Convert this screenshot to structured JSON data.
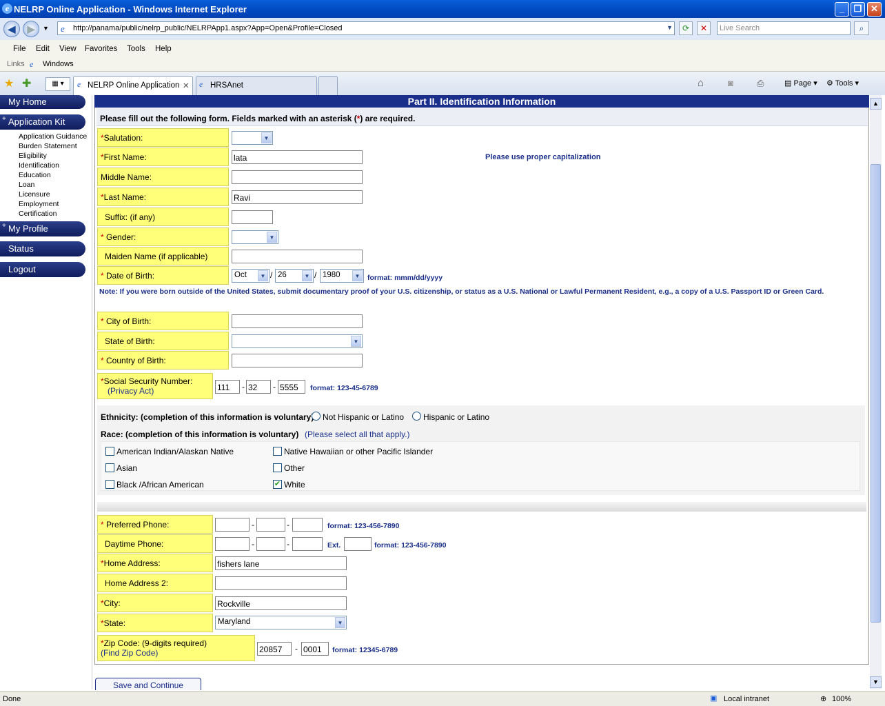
{
  "window": {
    "title": "NELRP Online Application - Windows Internet Explorer"
  },
  "browser": {
    "url": "http://panama/public/nelrp_public/NELRPApp1.aspx?App=Open&Profile=Closed",
    "search_placeholder": "Live Search",
    "menu": [
      "File",
      "Edit",
      "View",
      "Favorites",
      "Tools",
      "Help"
    ],
    "links_label": "Links",
    "links_item": "Windows",
    "tabs": [
      "NELRP Online Application",
      "HRSAnet"
    ],
    "cmd_page": "Page",
    "cmd_tools": "Tools"
  },
  "sidebar": {
    "my_home": "My Home",
    "app_kit": "Application Kit",
    "sub": [
      "Application Guidance",
      "Burden Statement",
      "Eligibility",
      "Identification",
      "Education",
      "Loan",
      "Licensure",
      "Employment",
      "Certification"
    ],
    "my_profile": "My Profile",
    "status": "Status",
    "logout": "Logout"
  },
  "form": {
    "header": "Part II. Identification Information",
    "instruction_pre": "Please fill out the following form. Fields marked with an asterisk (",
    "instruction_ast": "*",
    "instruction_post": ") are required.",
    "salutation": "Salutation:",
    "first_name": "First Name:",
    "first_name_value": "lata",
    "cap_hint": "Please use proper capitalization",
    "middle_name": "Middle Name:",
    "last_name": "Last Name:",
    "last_name_value": "Ravi",
    "suffix": "Suffix: (if any)",
    "gender": "Gender:",
    "maiden": "Maiden Name (if applicable)",
    "dob": "Date of Birth:",
    "dob_month": "Oct",
    "dob_day": "26",
    "dob_year": "1980",
    "dob_format": "format: mmm/dd/yyyy",
    "birth_note": "Note: If you were born outside of the United States, submit documentary proof of your U.S. citizenship, or status as a U.S. National or Lawful Permanent Resident, e.g., a copy of a U.S. Passport ID or Green Card.",
    "city_birth": "City of Birth:",
    "state_birth": "State of Birth:",
    "country_birth": "Country of Birth:",
    "ssn": "Social Security Number:",
    "privacy": "(Privacy Act)",
    "ssn1": "111",
    "ssn2": "32",
    "ssn3": "5555",
    "ssn_format": "format: 123-45-6789",
    "ethnicity": "Ethnicity: (completion of this information is voluntary)",
    "eth_opt1": "Not Hispanic or Latino",
    "eth_opt2": "Hispanic or Latino",
    "race": "Race: (completion of this information is voluntary)",
    "race_hint": "(Please select all that apply.)",
    "race_opts": [
      "American Indian/Alaskan Native",
      "Native Hawaiian or other Pacific Islander",
      "Asian",
      "Other",
      "Black /African American",
      "White"
    ],
    "pref_phone": "Preferred Phone:",
    "phone_format": "format: 123-456-7890",
    "day_phone": "Daytime Phone:",
    "ext": "Ext.",
    "home_addr": "Home Address:",
    "home_addr_value": "fishers lane",
    "home_addr2": "Home Address 2:",
    "city": "City:",
    "city_value": "Rockville",
    "state": "State:",
    "state_value": "Maryland",
    "zip": "Zip Code: (9-digits required)",
    "find_zip": "(Find Zip Code)",
    "zip1": "20857",
    "zip2": "0001",
    "zip_format": "format: 12345-6789",
    "save": "Save and Continue",
    "asterisk": "*",
    "dash": "-",
    "slash": "/"
  },
  "status": {
    "left": "Done",
    "zone": "Local intranet",
    "zoom": "100%"
  }
}
